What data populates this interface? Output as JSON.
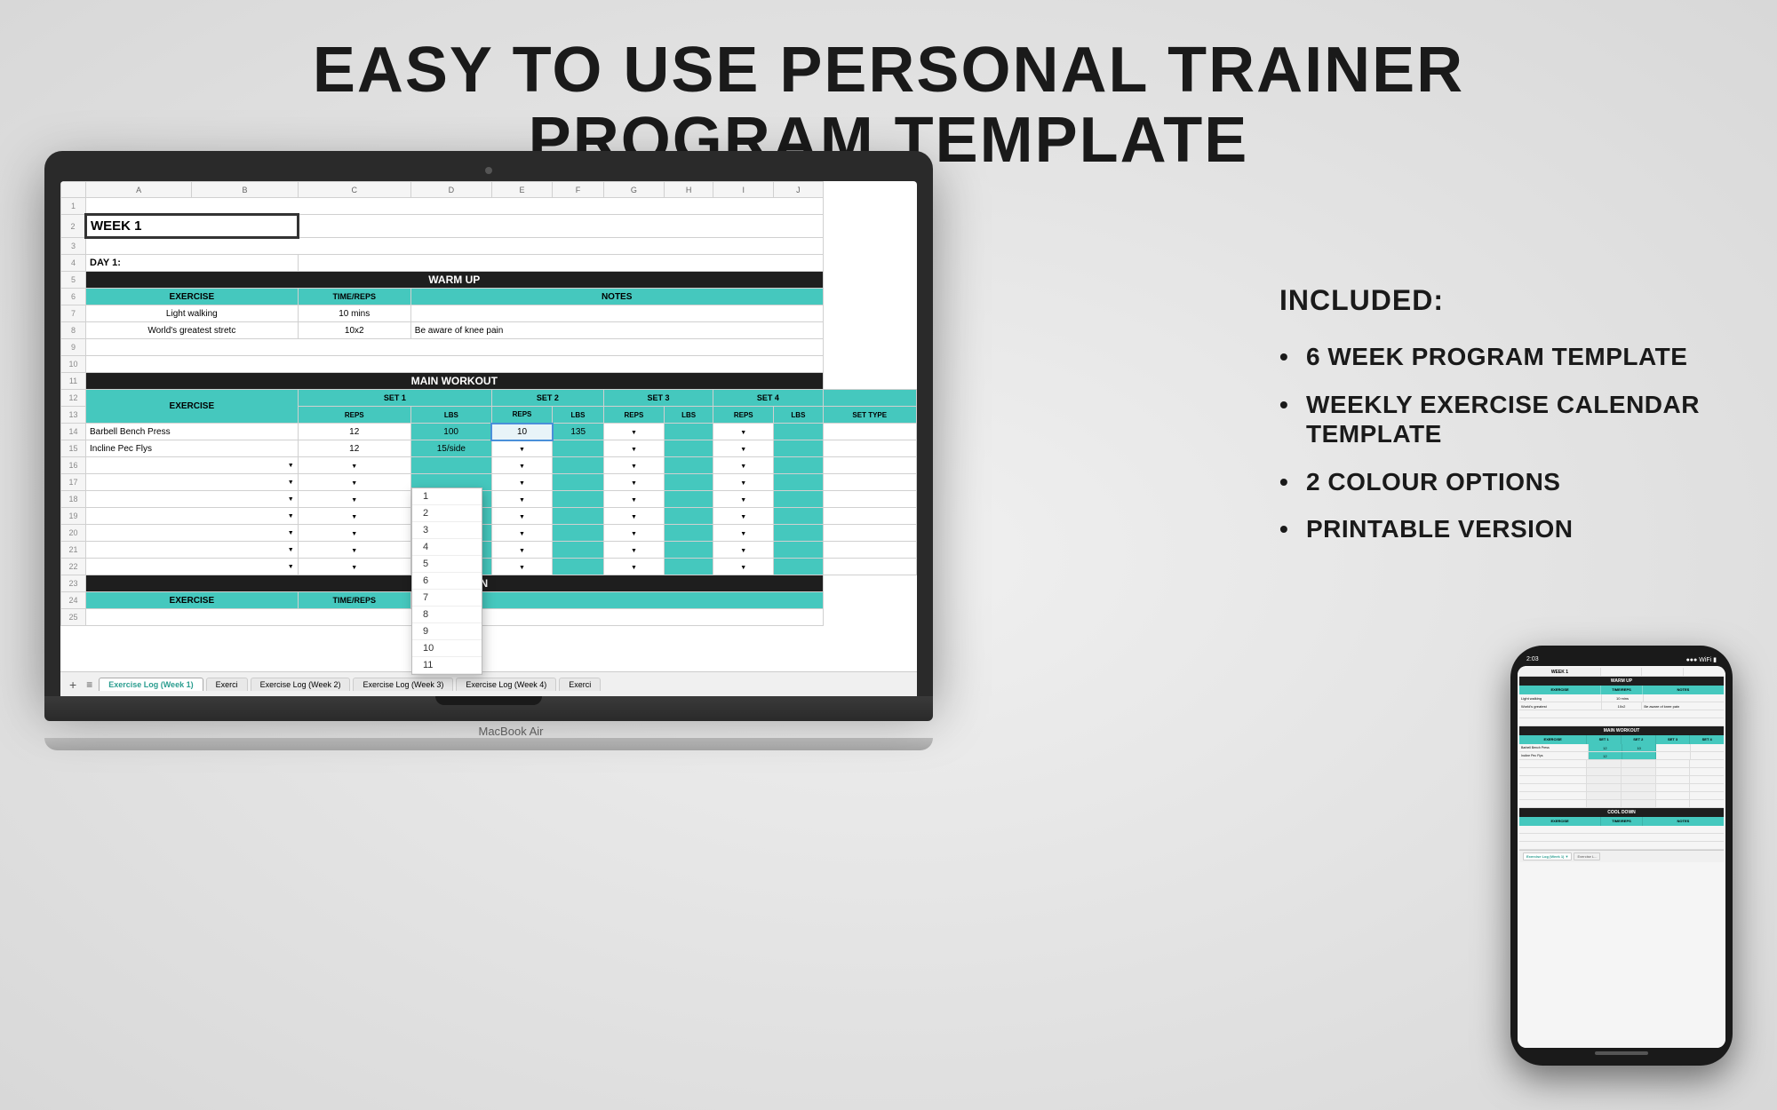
{
  "page": {
    "bg_color": "#e0e0e0",
    "title_line1": "EASY TO USE PERSONAL TRAINER",
    "title_line2": "PROGRAM TEMPLATE",
    "included_label": "INCLUDED:",
    "included_items": [
      "6 WEEK PROGRAM TEMPLATE",
      "WEEKLY EXERCISE CALENDAR TEMPLATE",
      "2 COLOUR OPTIONS",
      "PRINTABLE VERSION"
    ]
  },
  "spreadsheet": {
    "col_headers": [
      "A",
      "B",
      "C",
      "D",
      "E",
      "F",
      "G",
      "H",
      "I",
      "J"
    ],
    "week_label": "WEEK 1",
    "day1_label": "DAY 1:",
    "warm_up_label": "WARM UP",
    "exercise_label": "EXERCISE",
    "time_reps_label": "TIME/REPS",
    "notes_label": "NOTES",
    "warm_up_rows": [
      {
        "exercise": "Light walking",
        "time_reps": "10 mins",
        "notes": ""
      },
      {
        "exercise": "World's greatest stretc",
        "time_reps": "10x2",
        "notes": "Be aware of knee pain"
      }
    ],
    "main_workout_label": "MAIN WORKOUT",
    "set_labels": [
      "SET 1",
      "SET 2",
      "SET 3",
      "SET 4"
    ],
    "sub_headers": [
      "REPS",
      "LBS",
      "REPS",
      "LBS",
      "REPS",
      "LBS",
      "REPS",
      "LBS",
      "SET TYPE"
    ],
    "exercises": [
      {
        "name": "Barbell Bench Press",
        "s1_reps": "12",
        "s1_lbs": "100",
        "s2_reps": "10",
        "s2_lbs": "135"
      },
      {
        "name": "Incline Pec Flys",
        "s1_reps": "12",
        "s1_lbs": "15/side",
        "s2_reps": "",
        "s2_lbs": ""
      }
    ],
    "cool_down_label": "COOL DOWN",
    "tabs": [
      {
        "label": "Exercise Log (Week 1)",
        "active": true
      },
      {
        "label": "Exerci",
        "active": false
      },
      {
        "label": "Exercise Log (Week 2)",
        "active": false
      },
      {
        "label": "Exercise Log (Week 3)",
        "active": false
      },
      {
        "label": "Exercise Log (Week 4)",
        "active": false
      },
      {
        "label": "Exerci",
        "active": false
      }
    ],
    "dropdown_items": [
      "1",
      "2",
      "3",
      "4",
      "5",
      "6",
      "7",
      "8",
      "9",
      "10",
      "11"
    ]
  },
  "phone": {
    "time": "2:03",
    "label": "MacBook Air"
  },
  "icons": {
    "bullet": "•",
    "dropdown_arrow": "▼",
    "plus": "+",
    "list": "≡"
  }
}
